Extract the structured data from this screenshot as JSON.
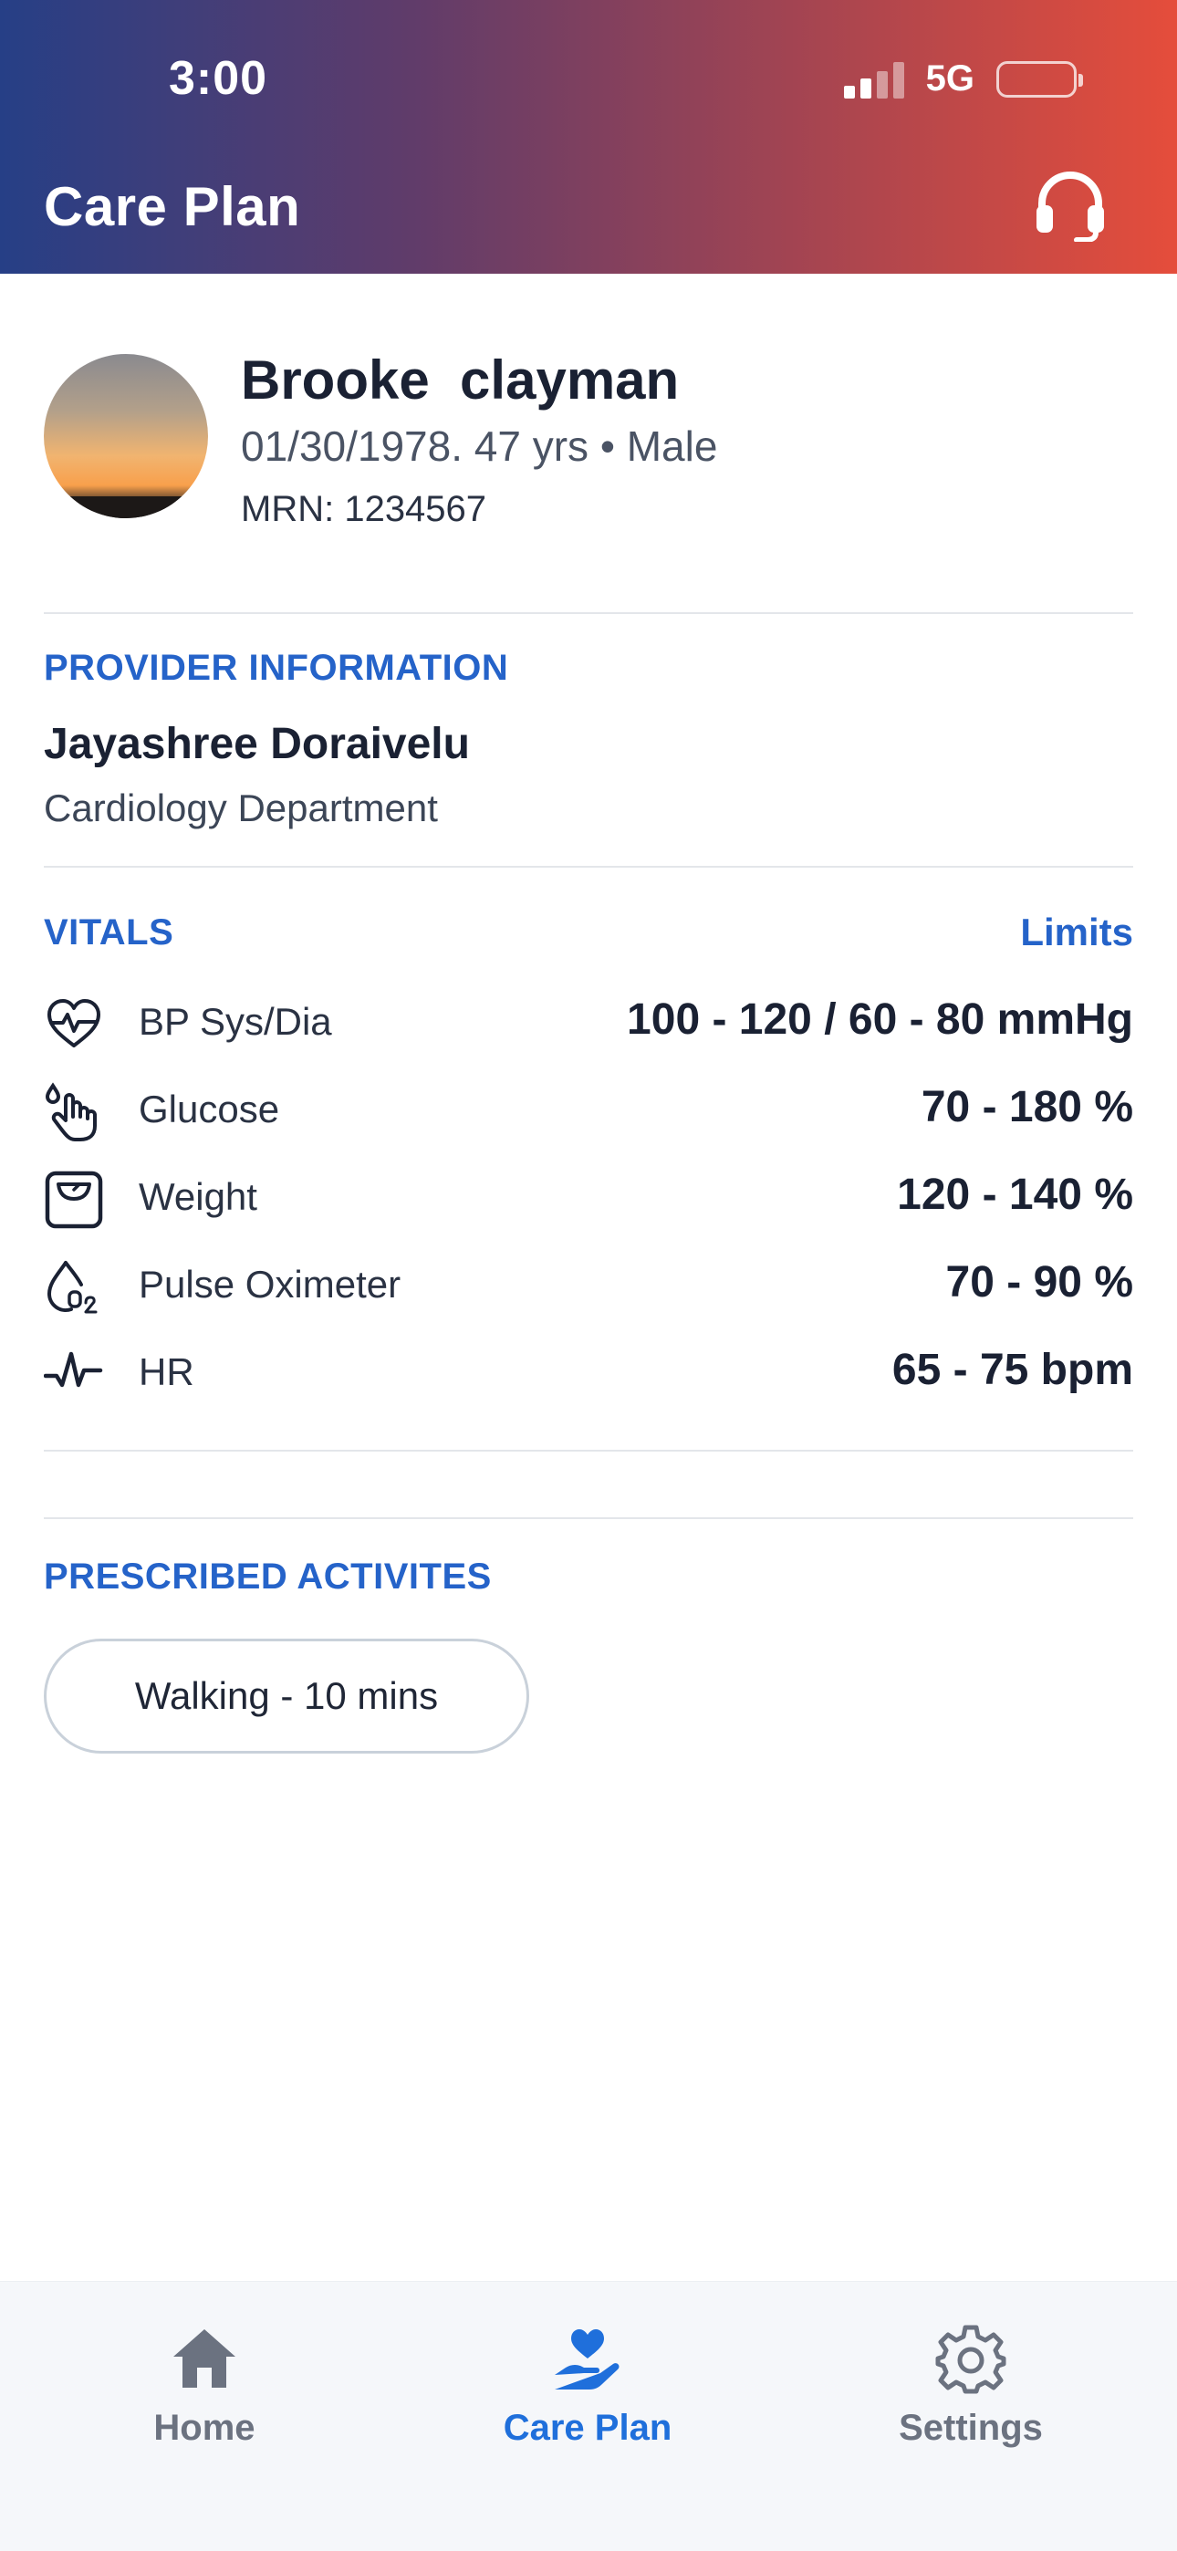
{
  "status_bar": {
    "time": "3:00",
    "network": "5G"
  },
  "header": {
    "title": "Care Plan"
  },
  "patient": {
    "name": "Brooke  clayman",
    "details": "01/30/1978. 47 yrs • Male",
    "mrn": "MRN: 1234567"
  },
  "provider": {
    "section_label": "PROVIDER INFORMATION",
    "name": "Jayashree Doraivelu",
    "department": "Cardiology Department"
  },
  "vitals": {
    "section_label": "VITALS",
    "limits_label": "Limits",
    "items": [
      {
        "label": "BP Sys/Dia",
        "value": "100 - 120 / 60 - 80 mmHg",
        "icon": "heart-pulse-icon"
      },
      {
        "label": "Glucose",
        "value": "70 - 180 %",
        "icon": "finger-drop-icon"
      },
      {
        "label": "Weight",
        "value": "120 - 140 %",
        "icon": "scale-icon"
      },
      {
        "label": "Pulse Oximeter",
        "value": "70 - 90 %",
        "icon": "o2-drop-icon"
      },
      {
        "label": "HR",
        "value": "65 - 75 bpm",
        "icon": "heartbeat-line-icon"
      }
    ]
  },
  "activities": {
    "section_label": "PRESCRIBED ACTIVITES",
    "items": [
      "Walking - 10 mins"
    ]
  },
  "tabbar": {
    "home": "Home",
    "care_plan": "Care Plan",
    "settings": "Settings",
    "active": "care_plan",
    "active_color": "#1f6fdb",
    "inactive_color": "#6b7280"
  },
  "colors": {
    "accent": "#2563c9",
    "header_gradient_start": "#263f86",
    "header_gradient_end": "#e54d3b"
  }
}
